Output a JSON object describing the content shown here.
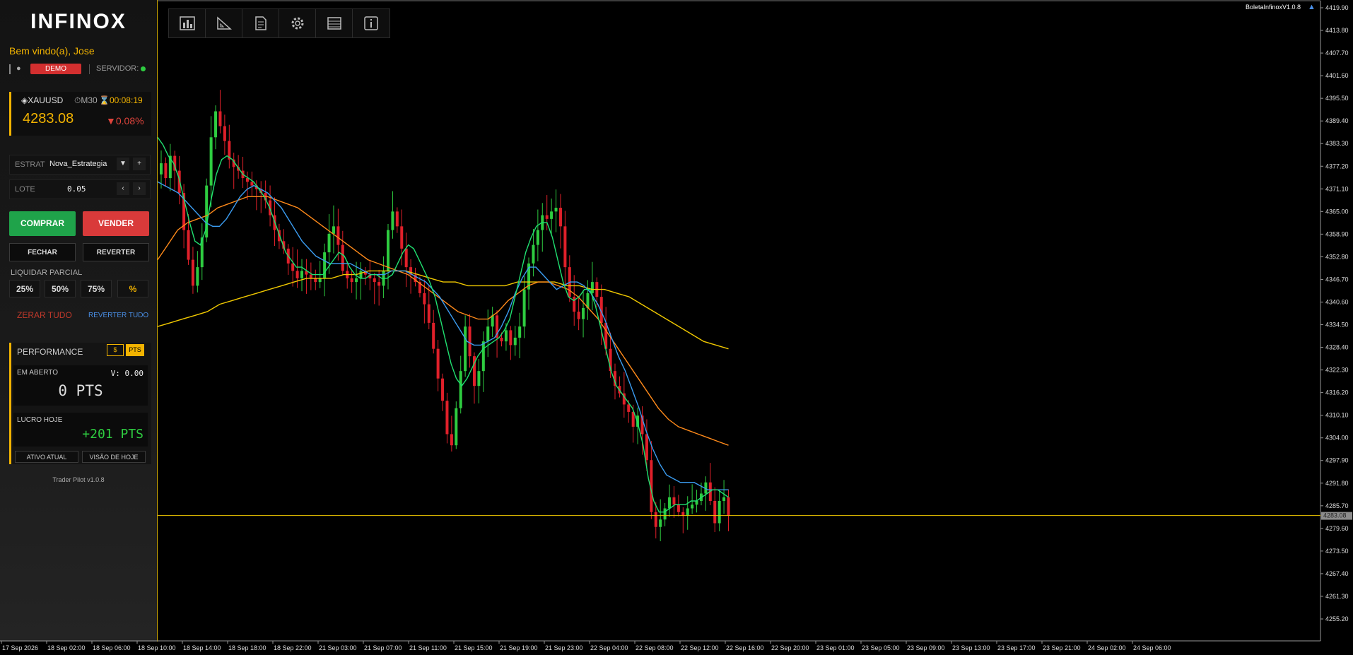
{
  "app": {
    "logo": "INFINOX",
    "welcome": "Bem vindo(a), Jose",
    "account_badge": "DEMO",
    "server_label": "SERVIDOR:",
    "version": "Trader Pilot v1.0.8"
  },
  "ticker": {
    "symbol": "XAUUSD",
    "timeframe": "M30",
    "countdown": "00:08:19",
    "price": "4283.08",
    "change": "0.08%"
  },
  "strategy": {
    "label": "ESTRAT",
    "value": "Nova_Estrategia",
    "dropdown": "▼",
    "add": "+"
  },
  "lot": {
    "label": "LOTE",
    "value": "0.05",
    "dec": "‹",
    "inc": "›"
  },
  "actions": {
    "buy": "COMPRAR",
    "sell": "VENDER",
    "close": "FECHAR",
    "reverse": "REVERTER",
    "partial_title": "LIQUIDAR PARCIAL",
    "partials": [
      "25%",
      "50%",
      "75%",
      "%"
    ],
    "zero_all": "ZERAR TUDO",
    "reverse_all": "REVERTER TUDO"
  },
  "performance": {
    "title": "PERFORMANCE",
    "toggle_currency": "$",
    "toggle_points": "PTS",
    "open_label": "EM ABERTO",
    "open_value": "V: 0.00",
    "open_points": "0 PTS",
    "today_label": "LUCRO HOJE",
    "today_points": "+201 PTS",
    "btn_current": "ATIVO ATUAL",
    "btn_today": "VISÃO DE HOJE"
  },
  "toolbar_icons": [
    "bar-chart-icon",
    "ruler-triangle-icon",
    "document-icon",
    "gear-icon",
    "table-icon",
    "info-icon"
  ],
  "expert": {
    "name": "BoletaInfinoxV1.0.8",
    "icon": "graduation-cap-icon"
  },
  "colors": {
    "accent": "#f2b300",
    "bull": "#2ecc40",
    "bear": "#e0202a",
    "ma_fast": "#20e070",
    "ma_mid": "#3b9cf0",
    "ma_slow": "#ff8a1a",
    "ma_long": "#f0c800"
  },
  "chart_data": {
    "type": "candlestick",
    "symbol": "XAUUSD",
    "timeframe": "M30",
    "y_ticks": [
      "4419.90",
      "4413.80",
      "4407.70",
      "4401.60",
      "4395.50",
      "4389.40",
      "4383.30",
      "4377.20",
      "4371.10",
      "4365.00",
      "4358.90",
      "4352.80",
      "4346.70",
      "4340.60",
      "4334.50",
      "4328.40",
      "4322.30",
      "4316.20",
      "4310.10",
      "4304.00",
      "4297.90",
      "4291.80",
      "4285.70",
      "4279.60",
      "4273.50",
      "4267.40",
      "4261.30",
      "4255.20"
    ],
    "ylim": [
      4252.9,
      4422.2
    ],
    "x_ticks": [
      "17 Sep 2026",
      "18 Sep 02:00",
      "18 Sep 06:00",
      "18 Sep 10:00",
      "18 Sep 14:00",
      "18 Sep 18:00",
      "18 Sep 22:00",
      "21 Sep 03:00",
      "21 Sep 07:00",
      "21 Sep 11:00",
      "21 Sep 15:00",
      "21 Sep 19:00",
      "21 Sep 23:00",
      "22 Sep 04:00",
      "22 Sep 08:00",
      "22 Sep 12:00",
      "22 Sep 16:00",
      "22 Sep 20:00",
      "23 Sep 01:00",
      "23 Sep 05:00",
      "23 Sep 09:00",
      "23 Sep 13:00",
      "23 Sep 17:00",
      "23 Sep 21:00",
      "24 Sep 02:00",
      "24 Sep 06:00"
    ],
    "current_price_line": 4283.08,
    "close_series": [
      4378,
      4374,
      4380,
      4376,
      4370,
      4360,
      4352,
      4345,
      4350,
      4358,
      4372,
      4385,
      4392,
      4388,
      4384,
      4379,
      4377,
      4376,
      4374,
      4373,
      4372,
      4371,
      4370,
      4368,
      4364,
      4360,
      4357,
      4355,
      4351,
      4349,
      4347,
      4349,
      4348,
      4347,
      4346,
      4347,
      4354,
      4359,
      4361,
      4356,
      4349,
      4347,
      4346,
      4347,
      4349,
      4348,
      4347,
      4346,
      4345,
      4349,
      4360,
      4365,
      4361,
      4355,
      4350,
      4348,
      4346,
      4343,
      4340,
      4335,
      4328,
      4320,
      4314,
      4305,
      4302,
      4312,
      4322,
      4334,
      4326,
      4318,
      4322,
      4330,
      4334,
      4337,
      4331,
      4330,
      4333,
      4329,
      4331,
      4334,
      4344,
      4351,
      4356,
      4360,
      4364,
      4363,
      4365,
      4366,
      4361,
      4350,
      4342,
      4338,
      4336,
      4339,
      4343,
      4346,
      4342,
      4335,
      4328,
      4322,
      4318,
      4316,
      4313,
      4311,
      4307,
      4310,
      4305,
      4298,
      4284,
      4280,
      4282,
      4285,
      4288,
      4286,
      4284,
      4283,
      4285,
      4286,
      4287,
      4289,
      4292,
      4287,
      4281,
      4287,
      4288,
      4283
    ],
    "ma_fast_series": [
      4385,
      4383,
      4380,
      4378,
      4374,
      4368,
      4362,
      4357,
      4356,
      4360,
      4368,
      4375,
      4379,
      4380,
      4379,
      4377,
      4375,
      4374,
      4373,
      4371,
      4369,
      4366,
      4362,
      4358,
      4354,
      4352,
      4350,
      4350,
      4349,
      4348,
      4348,
      4348,
      4350,
      4352,
      4354,
      4353,
      4350,
      4348,
      4347,
      4347,
      4348,
      4348,
      4347,
      4347,
      4348,
      4351,
      4354,
      4356,
      4355,
      4352,
      4349,
      4346,
      4342,
      4336,
      4330,
      4324,
      4320,
      4318,
      4320,
      4323,
      4326,
      4328,
      4329,
      4330,
      4331,
      4333,
      4336,
      4342,
      4348,
      4354,
      4358,
      4361,
      4362,
      4362,
      4358,
      4352,
      4346,
      4342,
      4341,
      4342,
      4344,
      4344,
      4340,
      4334,
      4328,
      4322,
      4318,
      4316,
      4314,
      4312,
      4308,
      4302,
      4293,
      4287,
      4284,
      4284,
      4285,
      4286,
      4286,
      4286,
      4287,
      4287,
      4288,
      4289,
      4290,
      4290,
      4289,
      4288
    ],
    "ma_mid_series": [
      4373,
      4372,
      4371,
      4370,
      4368,
      4366,
      4364,
      4362,
      4361,
      4361,
      4363,
      4366,
      4369,
      4371,
      4372,
      4371,
      4370,
      4368,
      4366,
      4363,
      4360,
      4357,
      4355,
      4353,
      4352,
      4351,
      4351,
      4351,
      4351,
      4350,
      4349,
      4348,
      4348,
      4348,
      4349,
      4349,
      4349,
      4348,
      4347,
      4346,
      4344,
      4342,
      4339,
      4336,
      4333,
      4330,
      4329,
      4329,
      4330,
      4331,
      4334,
      4338,
      4343,
      4347,
      4350,
      4350,
      4348,
      4346,
      4344,
      4345,
      4346,
      4346,
      4345,
      4343,
      4340,
      4336,
      4331,
      4326,
      4322,
      4317,
      4312,
      4306,
      4301,
      4297,
      4294,
      4293,
      4292,
      4292,
      4292,
      4291,
      4290,
      4290,
      4290,
      4290
    ],
    "ma_slow_series": [
      4352,
      4356,
      4360,
      4362,
      4363,
      4364,
      4366,
      4367,
      4368,
      4369,
      4369,
      4369,
      4368,
      4367,
      4366,
      4364,
      4362,
      4360,
      4358,
      4356,
      4354,
      4352,
      4351,
      4350,
      4349,
      4348,
      4346,
      4344,
      4342,
      4340,
      4338,
      4337,
      4336,
      4336,
      4338,
      4341,
      4343,
      4345,
      4346,
      4346,
      4345,
      4344,
      4342,
      4339,
      4336,
      4332,
      4328,
      4324,
      4320,
      4316,
      4312,
      4309,
      4307,
      4306,
      4305,
      4304,
      4303,
      4302
    ],
    "ma_long_series": [
      4334,
      4335,
      4336,
      4337,
      4338,
      4340,
      4341,
      4342,
      4343,
      4344,
      4345,
      4346,
      4347,
      4347,
      4347,
      4348,
      4348,
      4349,
      4349,
      4349,
      4349,
      4348,
      4347,
      4346,
      4346,
      4345,
      4345,
      4345,
      4345,
      4346,
      4346,
      4346,
      4346,
      4345,
      4345,
      4344,
      4344,
      4343,
      4342,
      4340,
      4338,
      4336,
      4334,
      4332,
      4330,
      4329,
      4328
    ]
  }
}
